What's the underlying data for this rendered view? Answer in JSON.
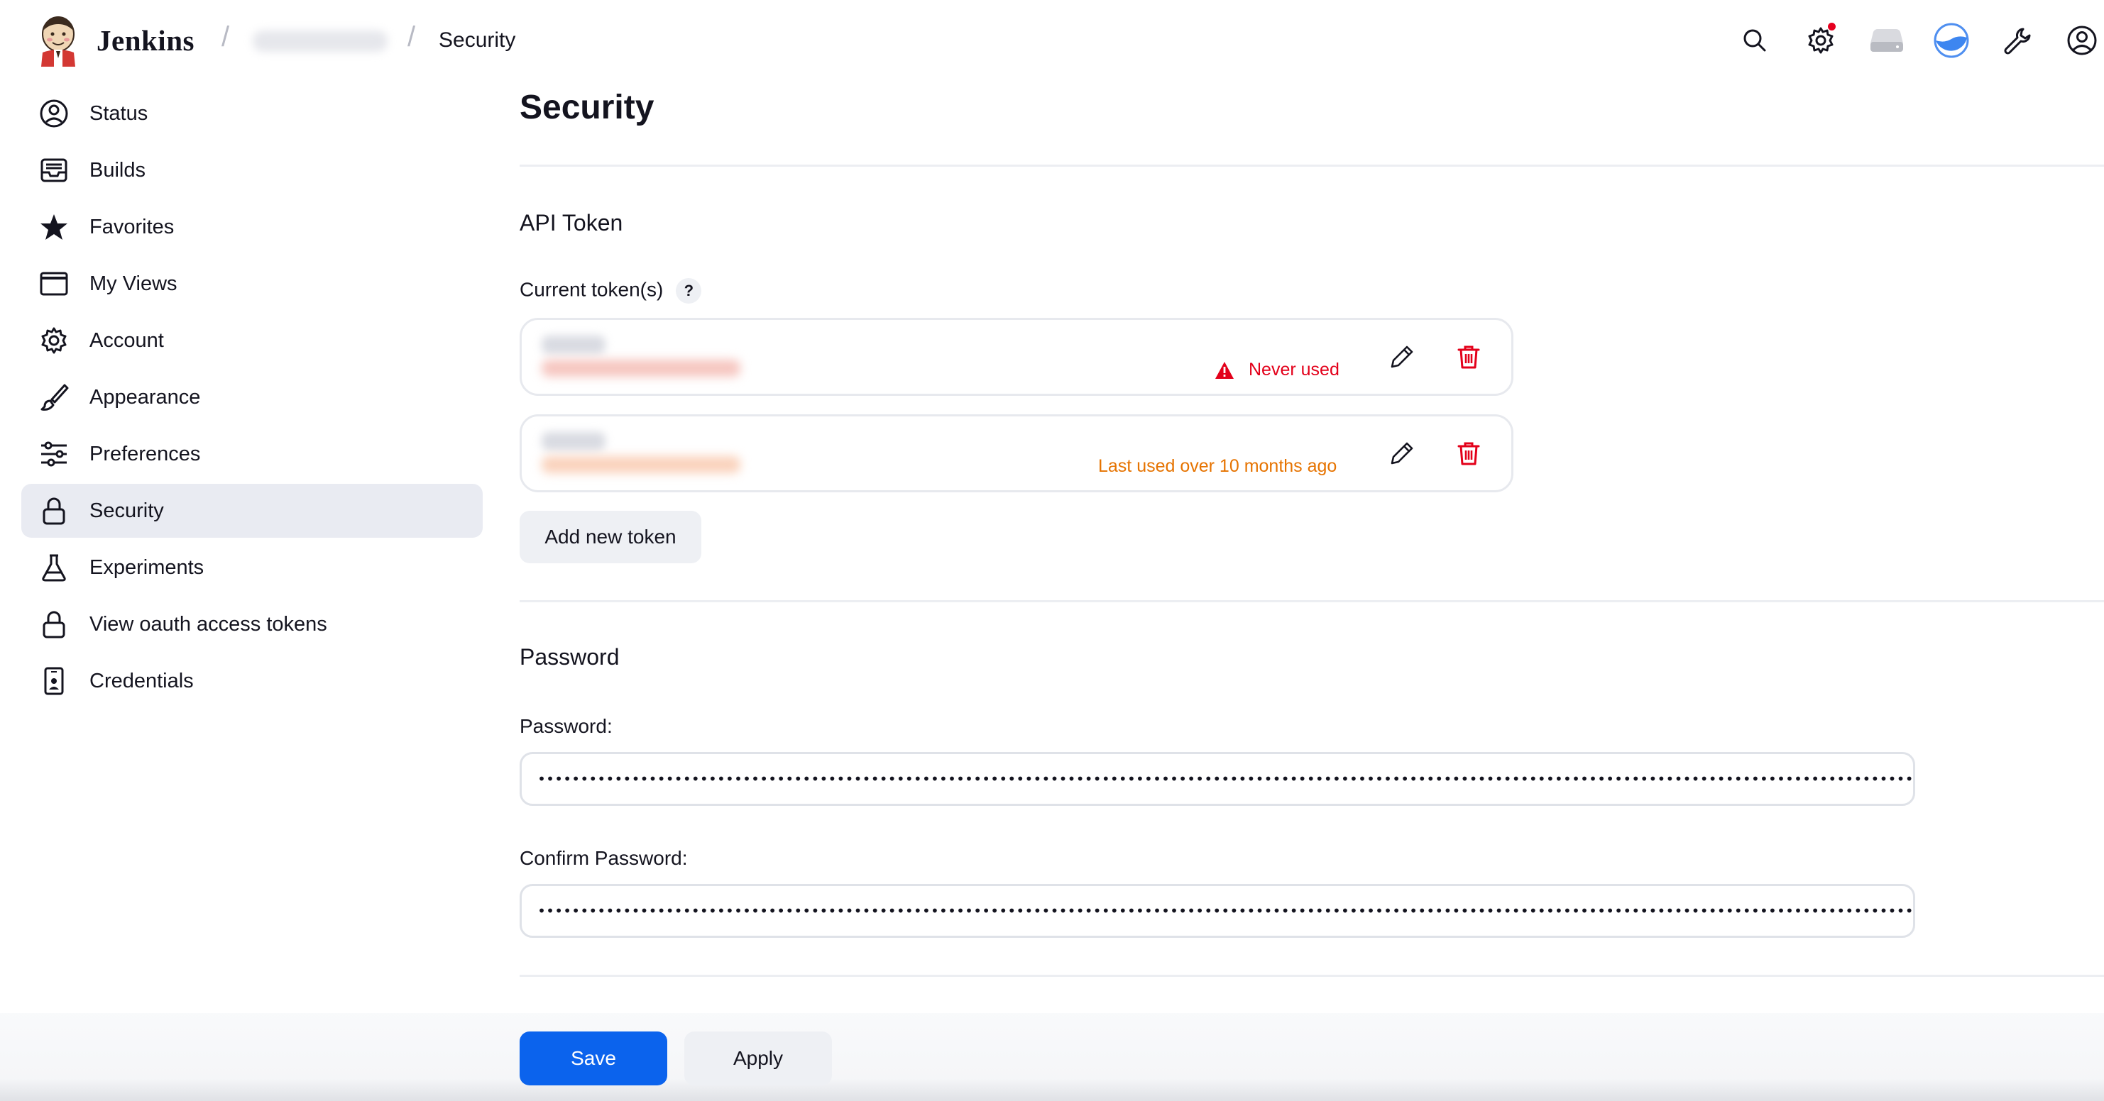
{
  "header": {
    "brand": "Jenkins",
    "breadcrumb_current": "Security",
    "icons": [
      "search-icon",
      "gear-icon",
      "drive-icon",
      "theme-icon",
      "wrench-icon",
      "user-icon"
    ]
  },
  "sidebar": {
    "items": [
      {
        "label": "Status",
        "icon": "user-circle-icon"
      },
      {
        "label": "Builds",
        "icon": "inbox-icon"
      },
      {
        "label": "Favorites",
        "icon": "star-icon"
      },
      {
        "label": "My Views",
        "icon": "window-icon"
      },
      {
        "label": "Account",
        "icon": "gear-icon"
      },
      {
        "label": "Appearance",
        "icon": "brush-icon"
      },
      {
        "label": "Preferences",
        "icon": "sliders-icon"
      },
      {
        "label": "Security",
        "icon": "lock-icon",
        "active": true
      },
      {
        "label": "Experiments",
        "icon": "flask-icon"
      },
      {
        "label": "View oauth access tokens",
        "icon": "lock-icon"
      },
      {
        "label": "Credentials",
        "icon": "phone-badge-icon"
      }
    ]
  },
  "main": {
    "title": "Security",
    "api_token": {
      "title": "API Token",
      "current_label": "Current token(s)",
      "help": "?",
      "tokens": [
        {
          "status": "Never used",
          "status_color": "#e3001a"
        },
        {
          "status": "Last used over 10 months ago",
          "status_color": "#e67300"
        }
      ],
      "add_button": "Add new token"
    },
    "password": {
      "title": "Password",
      "password_label": "Password:",
      "confirm_label": "Confirm Password:",
      "password_value": "•••••••••••••••••••••••••••••••••••••••••••••••••••••••••••••••••••••••••••••••••••••••••••••••••••••••••••••••••••••••••••••••••••••••••••••••••••••••••••••••••••••••••••",
      "confirm_value": "•••••••••••••••••••••••••••••••••••••••••••••••••••••••••••••••••••••••••••••••••••••••••••••••••••••••••••••••••••••••••••••••••••••••••••••••••••••••••••••••••••••••••••"
    },
    "buttons": {
      "save": "Save",
      "apply": "Apply"
    }
  },
  "colors": {
    "primary": "#0b63ed",
    "danger": "#e3001a",
    "warning": "#e67300",
    "active_bg": "#e9ebf2"
  }
}
